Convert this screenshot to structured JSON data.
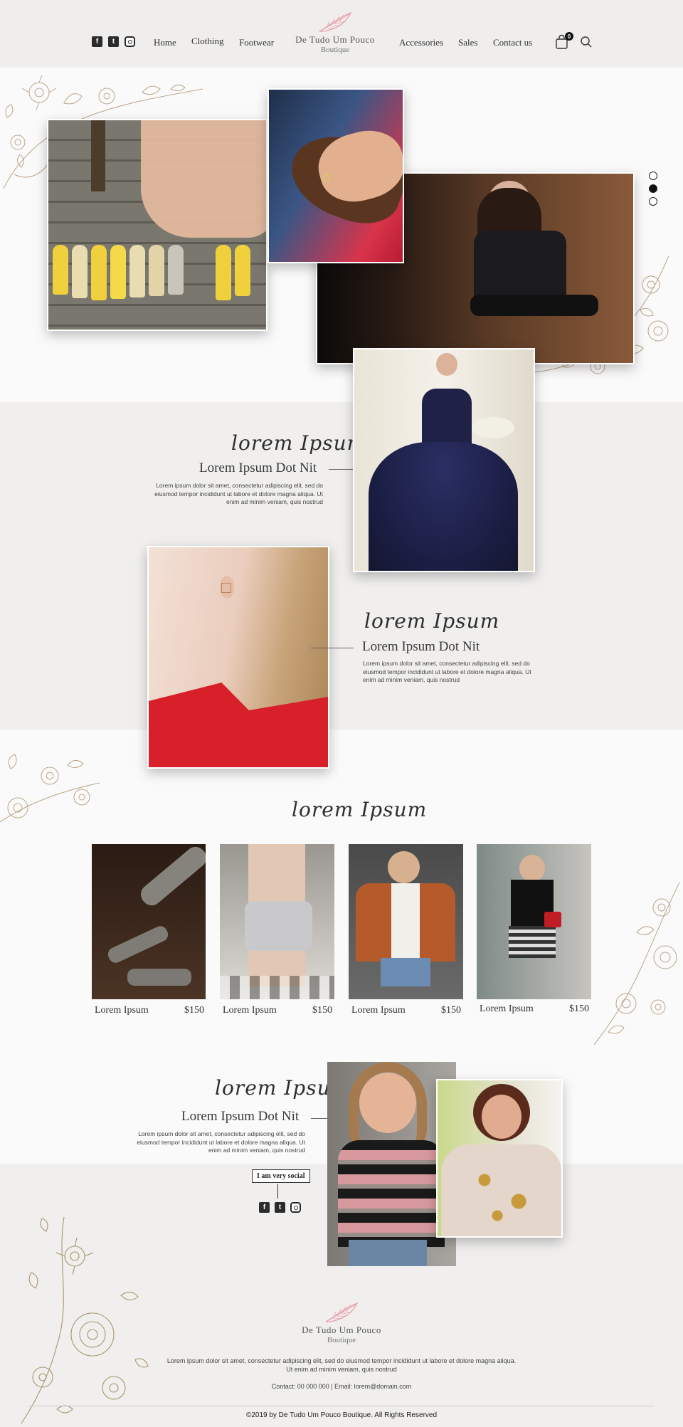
{
  "header": {
    "social": [
      "facebook-icon",
      "twitter-icon",
      "instagram-icon"
    ],
    "nav_left": [
      "Home",
      "Clothing",
      "Footwear"
    ],
    "nav_right": [
      "Accessories",
      "Sales",
      "Contact us"
    ],
    "logo_name": "De Tudo Um Pouco",
    "logo_sub": "Boutique",
    "cart_count": "0"
  },
  "hero": {
    "slides_total": 3,
    "active_slide": 2
  },
  "feature1": {
    "script": "lorem Ipsum",
    "title": "Lorem Ipsum Dot Nit",
    "text": "Lorem ipsum dolor sit amet, consectetur adipiscing elit, sed do eiusmod tempor incididunt ut labore et dolore magna aliqua. Ut enim ad minim veniam, quis nostrud"
  },
  "feature2": {
    "script": "lorem Ipsum",
    "title": "Lorem Ipsum Dot Nit",
    "text": "Lorem ipsum dolor sit amet, consectetur adipiscing elit, sed do eiusmod tempor incididunt ut labore et dolore magna aliqua. Ut enim ad minim veniam, quis nostrud"
  },
  "products": {
    "script": "lorem Ipsum",
    "items": [
      {
        "name": "Lorem Ipsum",
        "price": "$150"
      },
      {
        "name": "Lorem Ipsum",
        "price": "$150"
      },
      {
        "name": "Lorem Ipsum",
        "price": "$150"
      },
      {
        "name": "Lorem Ipsum",
        "price": "$150"
      }
    ]
  },
  "feature3": {
    "script": "lorem Ipsum",
    "title": "Lorem Ipsum Dot Nit",
    "text": "Lorem ipsum dolor sit amet, consectetur adipiscing elit, sed do eiusmod tempor incididunt ut labore et dolore magna aliqua. Ut enim ad minim veniam, quis nostrud"
  },
  "social_block": {
    "label": "I am very social"
  },
  "footer": {
    "logo_name": "De Tudo Um Pouco",
    "logo_sub": "Boutique",
    "text": "Lorem ipsum dolor sit amet, consectetur adipiscing elit, sed do eiusmod tempor incididunt ut labore et dolore magna aliqua. Ut enim ad minim veniam, quis nostrud",
    "contact": "Contact: 00 000 000",
    "email": "Email: lorem@domain.com",
    "copyright": "©2019 by De Tudo Um Pouco Boutique. All Rights Reserved"
  },
  "colors": {
    "accent": "#e8a0aa",
    "header_bg": "#efeeed",
    "band_bg": "#f0efee",
    "page_bg": "#fbfafa"
  }
}
